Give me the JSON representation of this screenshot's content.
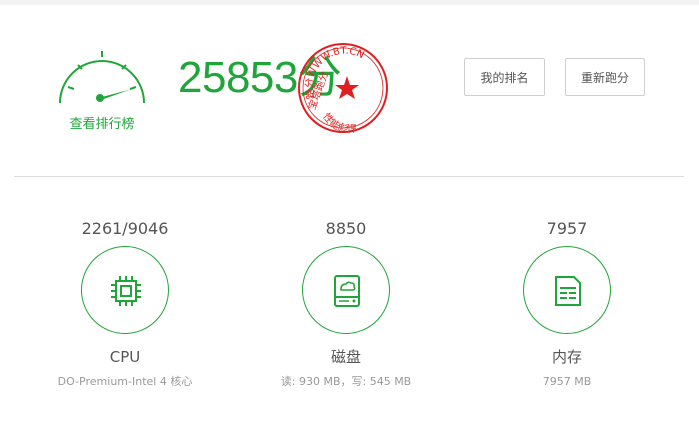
{
  "header": {
    "gauge_label": "查看排行榜",
    "score_value": "25853",
    "score_unit": "分",
    "stamp": {
      "top_text": "跑分WWW.BT.CN",
      "left_text": "宝塔跑分",
      "bottom_text": "性能彪悍",
      "color": "#e02020"
    },
    "buttons": {
      "my_rank": "我的排名",
      "rerun": "重新跑分"
    }
  },
  "metrics": [
    {
      "value": "2261/9046",
      "name": "CPU",
      "detail": "DO-Premium-Intel 4 核心",
      "icon": "cpu-icon"
    },
    {
      "value": "8850",
      "name": "磁盘",
      "detail": "读: 930 MB，写: 545 MB",
      "icon": "disk-icon"
    },
    {
      "value": "7957",
      "name": "内存",
      "detail": "7957 MB",
      "icon": "memory-icon"
    }
  ],
  "colors": {
    "accent": "#20a53a",
    "text": "#555555",
    "muted": "#999999",
    "stamp": "#e02020"
  }
}
